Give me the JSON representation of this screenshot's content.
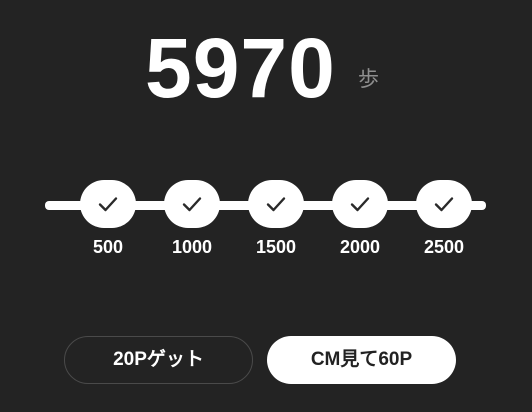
{
  "steps": {
    "count": "5970",
    "unit": "歩"
  },
  "milestones": [
    {
      "label": "500",
      "achieved": true,
      "icon": "check-icon"
    },
    {
      "label": "1000",
      "achieved": true,
      "icon": "check-icon"
    },
    {
      "label": "1500",
      "achieved": true,
      "icon": "check-icon"
    },
    {
      "label": "2000",
      "achieved": true,
      "icon": "check-icon"
    },
    {
      "label": "2500",
      "achieved": true,
      "icon": "check-icon"
    }
  ],
  "buttons": {
    "get_points": "20Pゲット",
    "watch_cm": "CM見て60P"
  },
  "colors": {
    "background": "#232323",
    "accent": "#ffffff",
    "unit_text": "#8f8f8f"
  }
}
